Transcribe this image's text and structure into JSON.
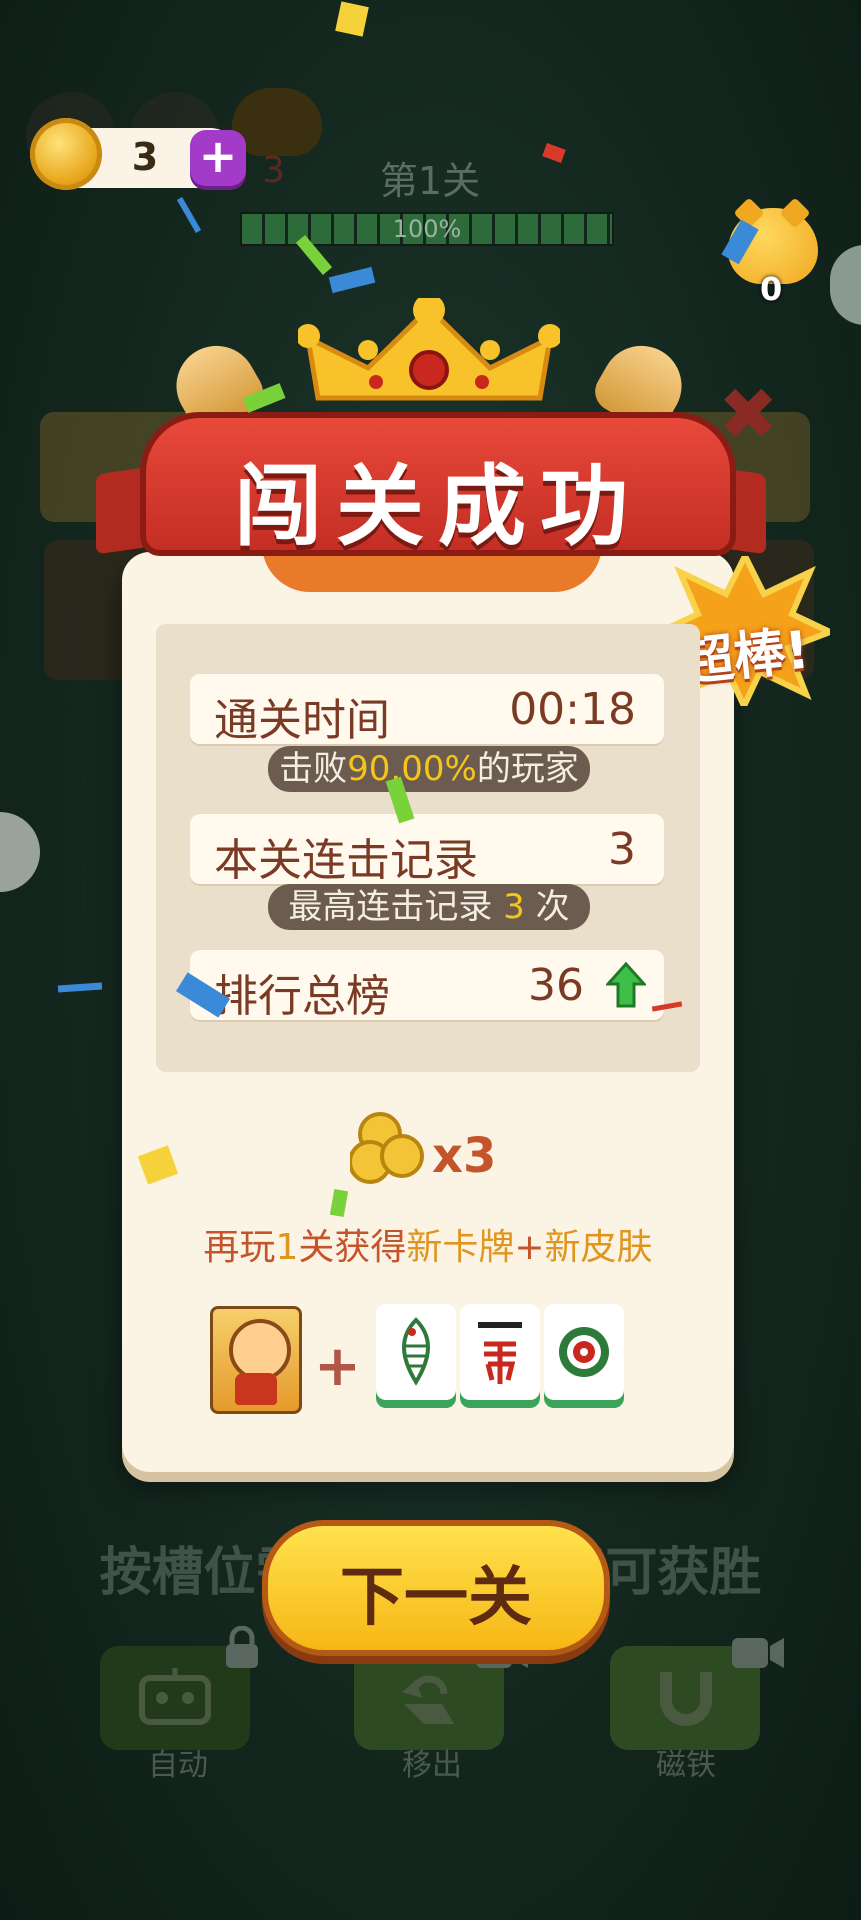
{
  "hud": {
    "coins": "3",
    "plus": "+",
    "level_title": "第1关",
    "progress": 1.0,
    "progress_text": "100%",
    "piggy_left_count": "3",
    "piggy_right_count": "0"
  },
  "dialog": {
    "title": "闯关成功",
    "badge": "超棒!",
    "stats": [
      {
        "label": "通关时间",
        "value": "00:18"
      },
      {
        "label": "本关连击记录",
        "value": "3"
      },
      {
        "label": "排行总榜",
        "value": "36"
      }
    ],
    "beat_prefix": "击败",
    "beat_value": "90.00%",
    "beat_suffix": "的玩家",
    "combo_prefix": "最高连击记录",
    "combo_value": "3",
    "combo_suffix": "次",
    "reward_multiplier": "x3",
    "unlock_text": {
      "prefix": "再玩",
      "count": "1",
      "mid": "关获得",
      "item1": "新卡牌",
      "plus": "+",
      "item2": "新皮肤"
    },
    "plus_sign": "+",
    "next_button": "下一关"
  },
  "background": {
    "hint": "按槽位需■■■■■即可获胜",
    "tools": [
      {
        "label": "自动",
        "icon": "robot-icon"
      },
      {
        "label": "移出",
        "icon": "undo-icon"
      },
      {
        "label": "磁铁",
        "icon": "magnet-icon"
      }
    ]
  },
  "colors": {
    "ribbon": "#c42e24",
    "card": "#fbf3e4",
    "text_brown": "#7a3a24",
    "highlight": "#f5c518",
    "button_yellow": "#f6b715"
  }
}
